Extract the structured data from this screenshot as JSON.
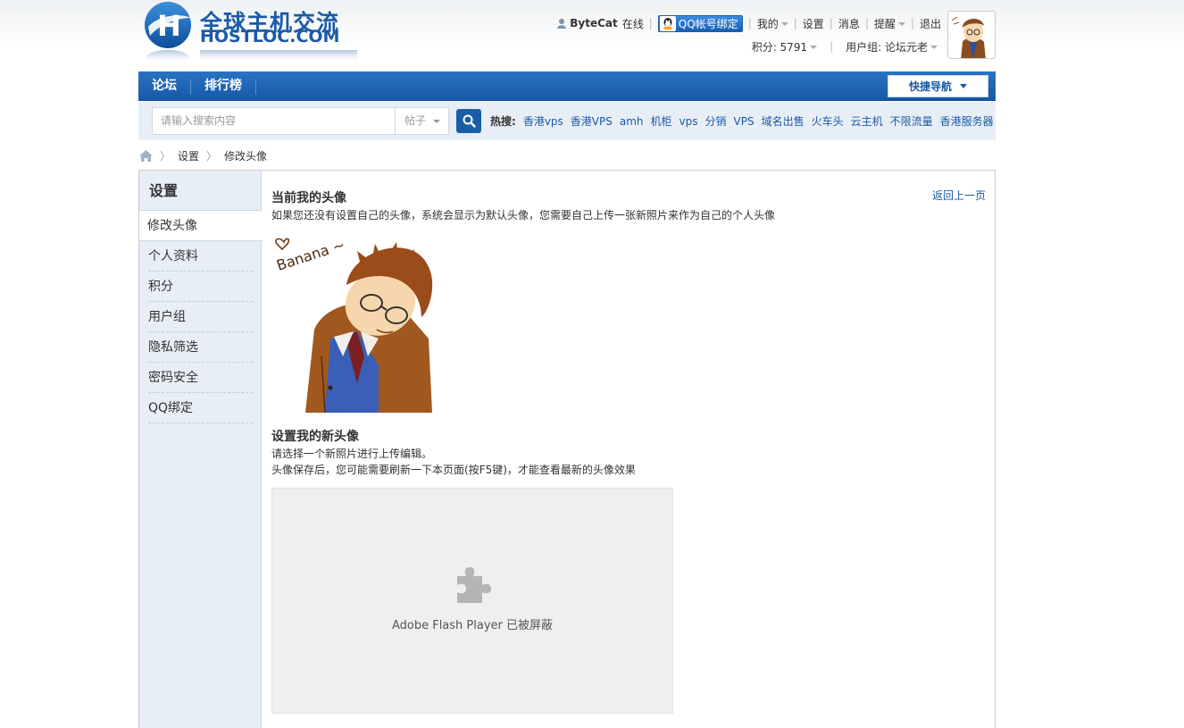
{
  "header": {
    "logo_text": "全球主机交流",
    "logo_domain": "HOSTLOC.COM",
    "username": "ByteCat",
    "online_status": "在线",
    "qq_bind_label": "QQ帐号绑定",
    "menu": [
      "我的",
      "设置",
      "消息",
      "提醒",
      "退出"
    ],
    "points_label": "积分: 5791",
    "usergroup_label": "用户组: 论坛元老"
  },
  "nav": {
    "items": [
      "论坛",
      "排行榜"
    ],
    "quick_nav_label": "快捷导航"
  },
  "search": {
    "placeholder": "请输入搜索内容",
    "type_selected": "帖子",
    "hot_label": "热搜:",
    "hot_terms": [
      "香港vps",
      "香港VPS",
      "amh",
      "机柜",
      "vps",
      "分销",
      "VPS",
      "域名出售",
      "火车头",
      "云主机",
      "不限流量",
      "香港服务器"
    ]
  },
  "breadcrumb": [
    "设置",
    "修改头像"
  ],
  "sidebar": {
    "title": "设置",
    "active": "修改头像",
    "items": [
      "个人资料",
      "积分",
      "用户组",
      "隐私筛选",
      "密码安全",
      "QQ绑定"
    ]
  },
  "content": {
    "current_title": "当前我的头像",
    "back_link": "返回上一页",
    "current_desc": "如果您还没有设置自己的头像，系统会显示为默认头像，您需要自己上传一张新照片来作为自己的个人头像",
    "avatar_caption": "Banana ~",
    "new_title": "设置我的新头像",
    "new_line1": "请选择一个新照片进行上传编辑。",
    "new_line2": "头像保存后，您可能需要刷新一下本页面(按F5键)，才能查看最新的头像效果",
    "flash_blocked": "Adobe Flash Player 已被屏蔽"
  },
  "colors": {
    "nav_blue": "#1a62b3",
    "link_blue": "#1a5aa8",
    "side_bg": "#e8eef5"
  }
}
